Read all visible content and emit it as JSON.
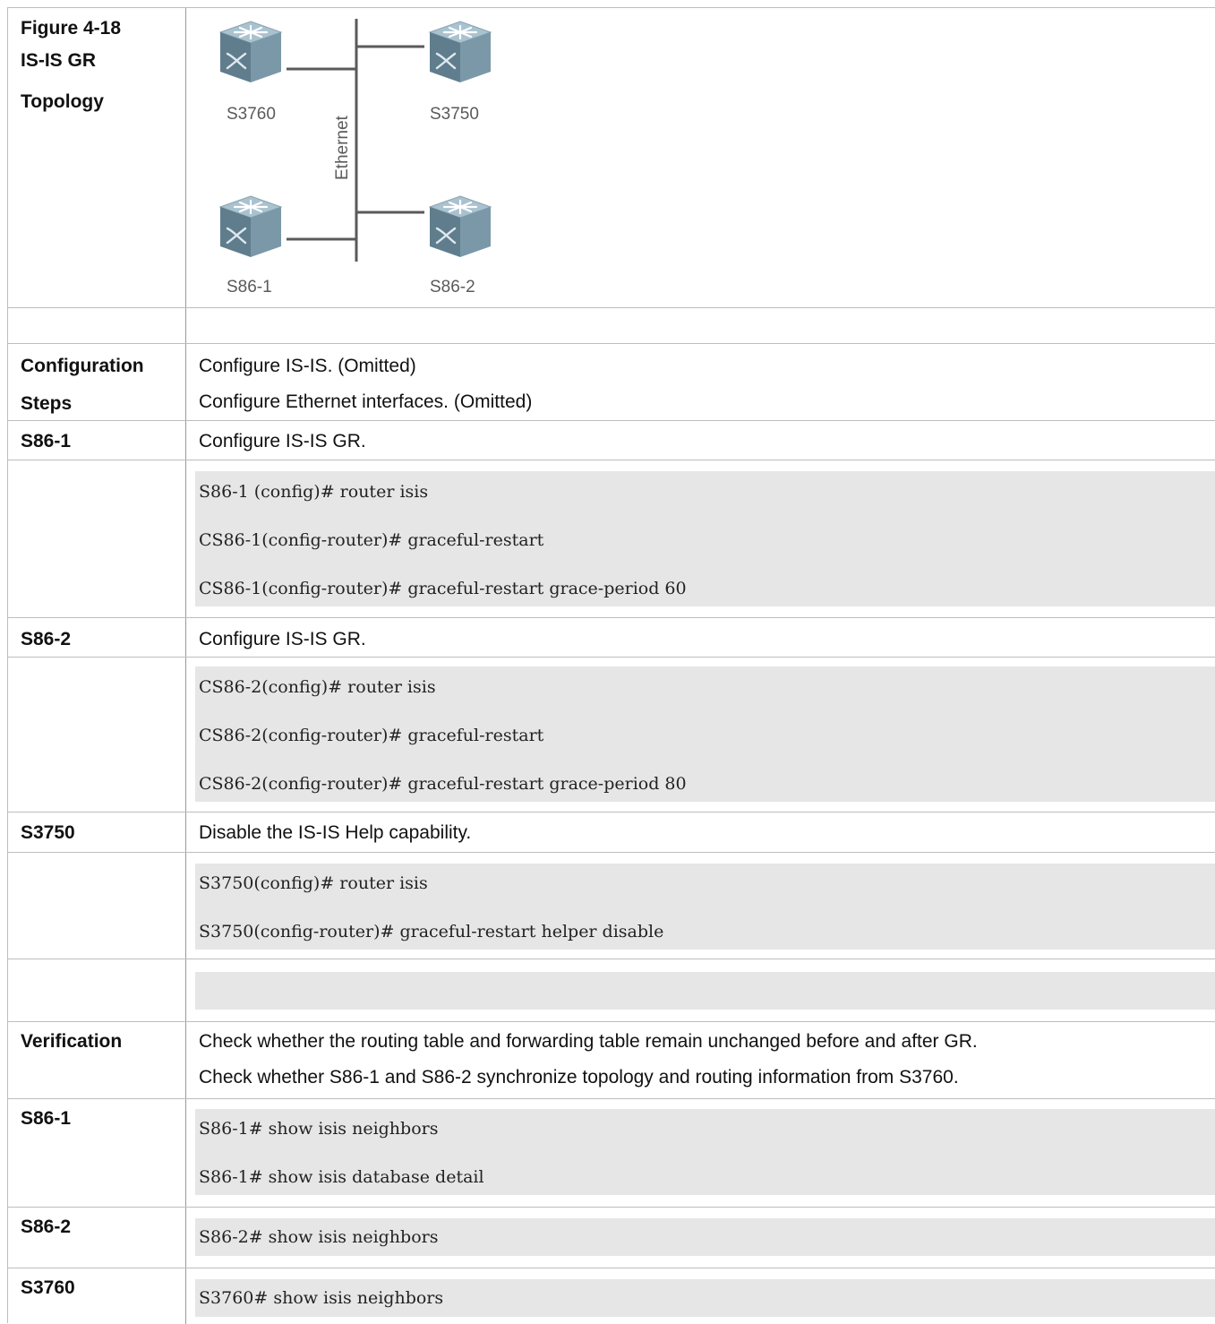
{
  "figure": {
    "caption_line1": "Figure 4-18",
    "caption_line2": "IS-IS GR",
    "caption_line3": "Topology",
    "devices": [
      "S3760",
      "S3750",
      "S86-1",
      "S86-2"
    ],
    "segment_label": "Ethernet",
    "device_icon": "switch-icon"
  },
  "rows": {
    "config_label_1": "Configuration",
    "config_label_2": "Steps",
    "config_step_1": "Configure IS-IS. (Omitted)",
    "config_step_2": "Configure Ethernet interfaces. (Omitted)",
    "s861_label": "S86-1",
    "s861_desc": "Configure IS-IS GR.",
    "s861_code": [
      "S86-1 (config)# router isis",
      "CS86-1(config-router)# graceful-restart",
      "CS86-1(config-router)# graceful-restart grace-period 60"
    ],
    "s862_label": "S86-2",
    "s862_desc": "Configure IS-IS GR.",
    "s862_code": [
      "CS86-2(config)# router isis",
      "CS86-2(config-router)# graceful-restart",
      "CS86-2(config-router)# graceful-restart grace-period 80"
    ],
    "s3750_label": "S3750",
    "s3750_desc": "Disable the IS-IS Help capability.",
    "s3750_code": [
      "S3750(config)# router isis",
      "S3750(config-router)# graceful-restart helper disable"
    ],
    "verification_label": "Verification",
    "verification_1": "Check whether the routing table and forwarding table remain unchanged before and after GR.",
    "verification_2": "Check whether S86-1 and S86-2 synchronize topology and routing information from S3760.",
    "v_s861_label": "S86-1",
    "v_s861_code": [
      "S86-1# show isis neighbors",
      "S86-1# show isis database detail"
    ],
    "v_s862_label": "S86-2",
    "v_s862_code": [
      "S86-2# show isis neighbors"
    ],
    "v_s3760_label": "S3760",
    "v_s3760_code": [
      "S3760# show isis neighbors"
    ]
  },
  "colors": {
    "code_background": "#e6e6e6",
    "switch_body": "#6f8c9c",
    "switch_top": "#a9c2cf"
  }
}
